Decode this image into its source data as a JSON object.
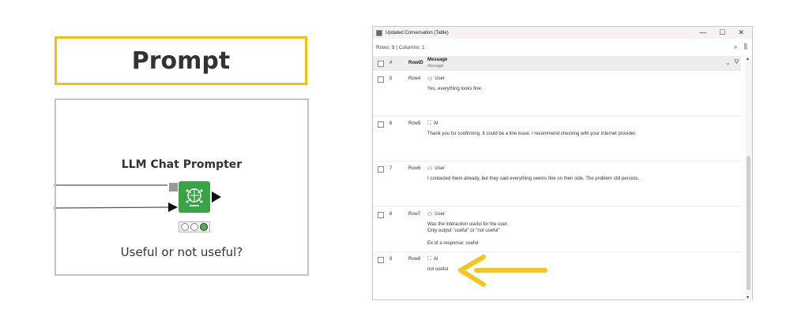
{
  "left_panel": {
    "prompt_title": "Prompt",
    "node_title": "LLM Chat Prompter",
    "node_caption": "Useful or not useful?"
  },
  "window": {
    "title": "Updated Conversation (Table)",
    "controls": {
      "minimize": "—",
      "maximize": "☐",
      "close": "✕"
    },
    "info": "Rows: 9   |   Columns: 1",
    "tools": {
      "search": "⌕",
      "settings": "⫼"
    },
    "header": {
      "index": "#",
      "rowid": "RowID",
      "message": "Message",
      "message_type": "Message",
      "expand": "⌄",
      "filter": "⛛"
    }
  },
  "rows": [
    {
      "num": "5",
      "rowid": "Row4",
      "role": "User",
      "message": "Yes, everything looks fine."
    },
    {
      "num": "6",
      "rowid": "Row5",
      "role": "AI",
      "message": "Thank you for confirming. It could be a line issue. I recommend checking with your internet provider."
    },
    {
      "num": "7",
      "rowid": "Row6",
      "role": "User",
      "message": "I contacted them already, but they said everything seems fine on their side. The problem still persists."
    },
    {
      "num": "8",
      "rowid": "Row7",
      "role": "User",
      "message": "Was the interaction useful for the user.\nOnly output \"useful\" or \"not useful\"\n\nEx of a response: useful"
    },
    {
      "num": "9",
      "rowid": "Row8",
      "role": "AI",
      "message": "not useful"
    }
  ],
  "colors": {
    "prompt_border": "#f2c10f",
    "node_green": "#3aa348",
    "arrow": "#f5c518"
  }
}
